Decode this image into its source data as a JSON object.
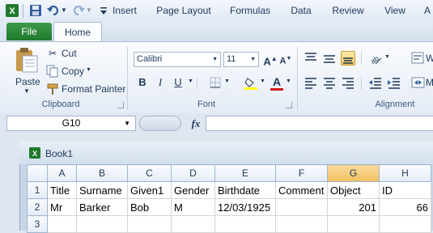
{
  "qat": {
    "icons": [
      "excel-logo-icon",
      "save-icon",
      "undo-icon",
      "redo-icon",
      "customize-qat-icon"
    ]
  },
  "tabs": {
    "file": "File",
    "home": "Home",
    "insert": "Insert",
    "page_layout": "Page Layout",
    "formulas": "Formulas",
    "data": "Data",
    "review": "Review",
    "view": "View",
    "partial": "A"
  },
  "clipboard": {
    "paste": "Paste",
    "cut": "Cut",
    "copy": "Copy",
    "format_painter": "Format Painter",
    "group": "Clipboard"
  },
  "font": {
    "name": "Calibri",
    "size": "11",
    "bold": "B",
    "italic": "I",
    "underline": "U",
    "grow": "A",
    "shrink": "A",
    "color_glyph": "A",
    "group": "Font"
  },
  "alignment": {
    "group": "Alignment"
  },
  "formula_bar": {
    "name_box": "G10",
    "fx": "fx",
    "value": ""
  },
  "workbook": {
    "title": "Book1"
  },
  "sheet": {
    "columns": [
      "A",
      "B",
      "C",
      "D",
      "E",
      "F",
      "G",
      "H"
    ],
    "selected_column": "G",
    "rows": [
      {
        "header": "1",
        "cells": [
          "Title",
          "Surname",
          "Given1",
          "Gender",
          "Birthdate",
          "Comment",
          "Object",
          "ID"
        ]
      },
      {
        "header": "2",
        "cells": [
          "Mr",
          "Barker",
          "Bob",
          "M",
          "12/03/1925",
          "",
          "201",
          "66"
        ]
      },
      {
        "header": "3",
        "cells": [
          "",
          "",
          "",
          "",
          "",
          "",
          "",
          ""
        ]
      }
    ]
  },
  "colors": {
    "file_tab": "#2a8838",
    "ribbon": "#f3f6fb",
    "selected_header": "#f5c96e"
  }
}
